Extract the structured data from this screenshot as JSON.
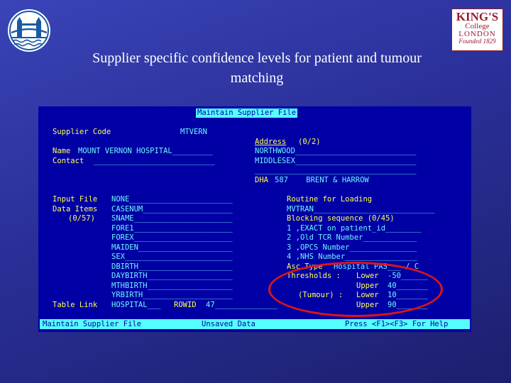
{
  "slide": {
    "title": "Supplier specific confidence levels for patient and tumour matching",
    "logo_right": {
      "line1": "KING'S",
      "line2": "College",
      "line3": "LONDON",
      "line4": "Founded 1829"
    }
  },
  "terminal": {
    "header": "Maintain Supplier File",
    "supplier_code_label": "Supplier Code",
    "supplier_code_value": "MTVERN",
    "name_label": "Name",
    "name_value": "MOUNT VERNON HOSPITAL_________",
    "contact_label": "Contact",
    "contact_value": "___________________________",
    "address_label": "Address",
    "address_count": "(0/2)",
    "address_lines": [
      "NORTHWOOD___________________________",
      "MIDDLESEX___________________________",
      "____________________________________"
    ],
    "dha_label": "DHA",
    "dha_value": "587    BRENT & HARROW",
    "input_file_label": "Input File",
    "input_file_value": "NONE_______________________",
    "data_items_label": "Data Items",
    "data_items_count": "(0/57)",
    "data_items": [
      "CASENUM____________________",
      "SNAME______________________",
      "FORE1______________________",
      "FOREX______________________",
      "MAIDEN_____________________",
      "SEX________________________",
      "DBIRTH_____________________",
      "DAYBIRTH___________________",
      "MTHBIRTH___________________",
      "YRBIRTH____________________"
    ],
    "table_link_label": "Table Link",
    "table_link_value": "HOSPITAL___",
    "rowid_label": "ROWID",
    "rowid_value": "47______________",
    "routine_label": "Routine for Loading",
    "routine_value": "MVTRAN___________________________",
    "blocking_label": "Blocking sequence (0/45)",
    "blocking": [
      "1 ,EXACT on patient_id________",
      "2 ,Old TCR Number____________",
      "3 ,OPCS Number_______________",
      "4 ,NHS Number________________"
    ],
    "assoc_label": "Asc Type",
    "assoc_value": "Hospital PAS___ / C",
    "thresholds_label": "Thresholds :",
    "tumour_label": "(Tumour) :",
    "lower_label": "Lower",
    "upper_label": "Upper",
    "patient_lower": "-50______",
    "patient_upper": "40_______",
    "tumour_lower": "10_______",
    "tumour_upper": "90_______",
    "status_left": "Maintain Supplier File",
    "status_mid": "Unsaved Data",
    "status_right": "Press <F1><F3> For Help"
  }
}
